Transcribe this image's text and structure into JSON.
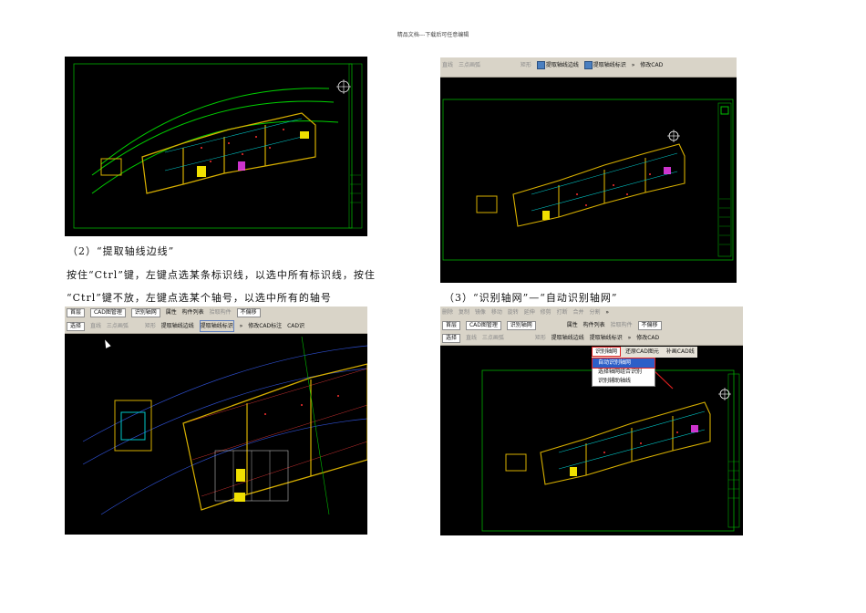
{
  "header": {
    "text": "精品文档---下载后可任意编辑"
  },
  "captions": {
    "c2_title": "（2）“提取轴线边线”",
    "c2_line1": "按住“Ctrl”键，左键点选某条标识线，以选中所有标识线，按住",
    "c2_line2": "“Ctrl”键不放，左键点选某个轴号，以选中所有的轴号",
    "c3_title": "（3）“识别轴网”—“自动识别轴网”"
  },
  "shot_tr": {
    "toolbar1": {
      "item1": "直线",
      "item2": "三点画弧",
      "item3": "矩形",
      "item4": "提取轴线边线",
      "item5": "提取轴线标识",
      "more": "»",
      "item6": "修改CAD"
    }
  },
  "shot_bl": {
    "toolbar1": {
      "item1": "首层",
      "item2": "CAD图管理",
      "item3": "识别轴网",
      "item4": "属性",
      "item5": "构件列表",
      "item6": "拾取构件",
      "item7": "不偏移"
    },
    "toolbar2": {
      "item1": "选择",
      "item2": "直线",
      "item3": "三点画弧",
      "item4": "矩形",
      "item5": "提取轴线边线",
      "item6": "提取轴线标识",
      "more": "»",
      "item7": "修改CAD标注",
      "item8": "CAD识"
    }
  },
  "shot_br": {
    "toolbar0": {
      "item1": "删除",
      "item2": "复制",
      "item3": "镜像",
      "item4": "移动",
      "item5": "旋转",
      "item6": "延伸",
      "item7": "修剪",
      "item8": "打断",
      "item9": "合并",
      "item10": "分割",
      "more": "»"
    },
    "toolbar1": {
      "item1": "首层",
      "item2": "CAD图管理",
      "item3": "识别轴网",
      "item4": "属性",
      "item5": "构件列表",
      "item6": "拾取构件",
      "item7": "不偏移"
    },
    "toolbar2": {
      "item1": "选择",
      "item2": "直线",
      "item3": "三点画弧",
      "item4": "矩形",
      "item5": "提取轴线边线",
      "item6": "提取轴线标识",
      "more": "»",
      "item7": "修改CAD"
    },
    "menu_button": "识别轴网",
    "restore_button": "还原CAD图元",
    "fill_button": "补画CAD线",
    "menu_items": [
      "自动识别轴网",
      "选择轴网组合识别",
      "识别辅助轴线"
    ]
  }
}
